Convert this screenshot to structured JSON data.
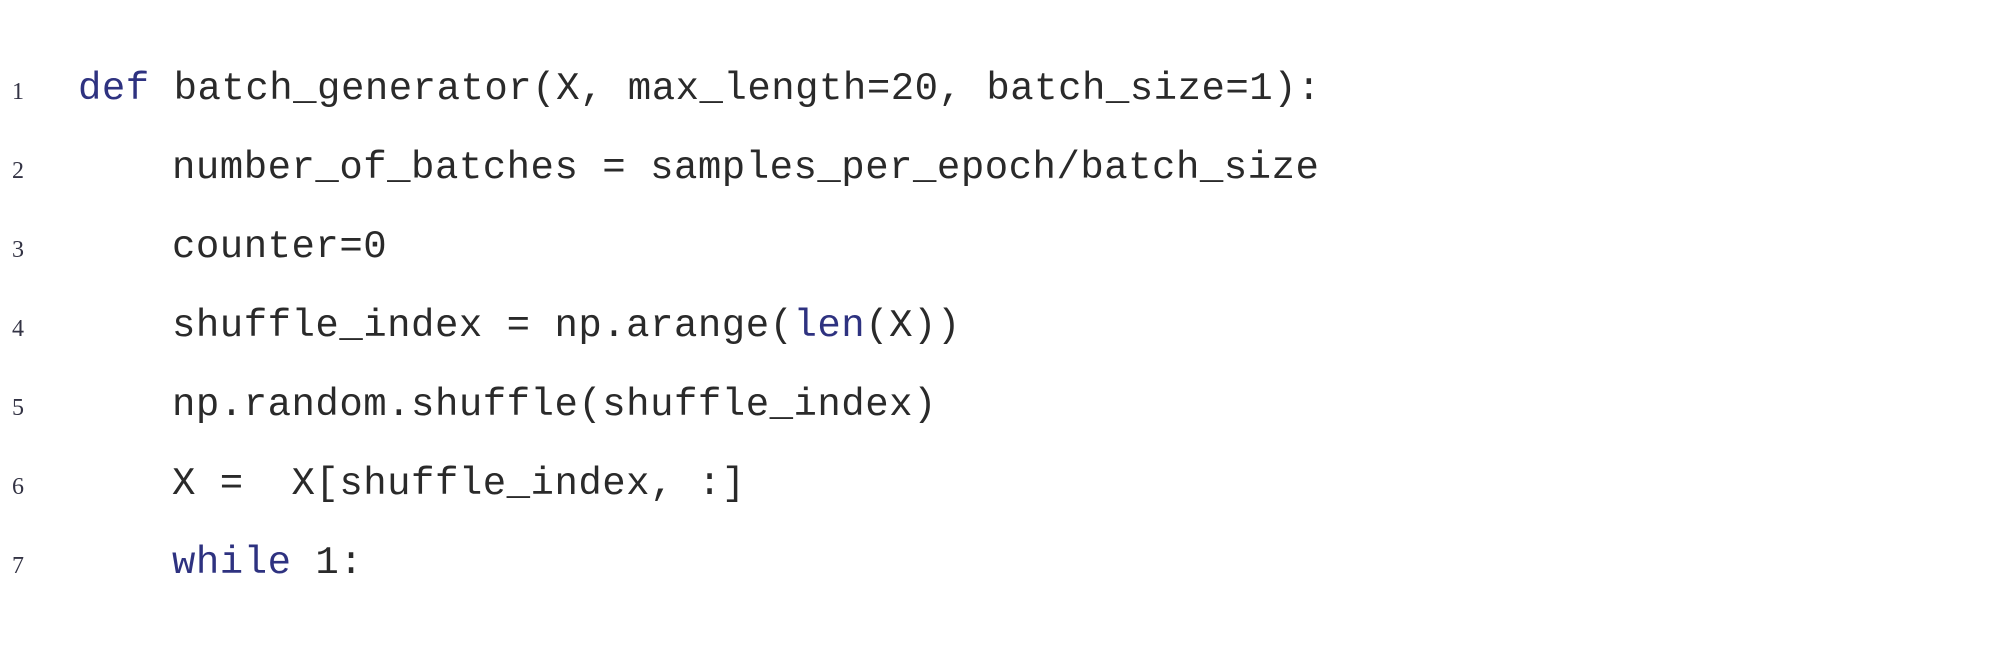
{
  "code_listing": {
    "lines": [
      {
        "number": "1",
        "indent": false,
        "keyword": "def",
        "text": " batch_generator(X, max_length=20, batch_size=1):"
      },
      {
        "number": "2",
        "indent": true,
        "text": "number_of_batches = samples_per_epoch/batch_size"
      },
      {
        "number": "3",
        "indent": true,
        "text": "counter=0"
      },
      {
        "number": "4",
        "indent": true,
        "pre": "shuffle_index = np.arange(",
        "builtin": "len",
        "post": "(X))"
      },
      {
        "number": "5",
        "indent": true,
        "text": "np.random.shuffle(shuffle_index)"
      },
      {
        "number": "6",
        "indent": true,
        "text": "X =  X[shuffle_index, :]"
      },
      {
        "number": "7",
        "indent": true,
        "keyword": "while",
        "text": " 1:"
      }
    ]
  },
  "colors": {
    "keyword": "#2e3280",
    "text": "#2a2a2a",
    "line_number": "#333344",
    "background": "#ffffff"
  }
}
